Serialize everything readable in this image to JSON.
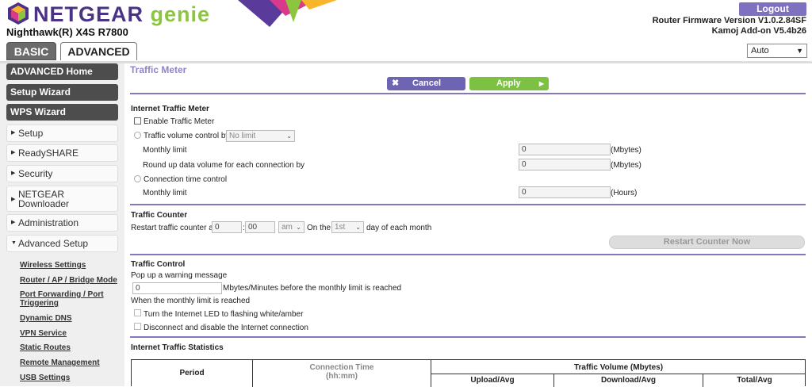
{
  "header": {
    "brand": "NETGEAR",
    "brand_suffix": "genie",
    "model": "Nighthawk(R) X4S R7800",
    "logout_label": "Logout",
    "firmware": "Router Firmware Version V1.0.2.84SF",
    "addon": "Kamoj Add-on V5.4b26",
    "tabs": {
      "basic": "BASIC",
      "advanced": "ADVANCED"
    },
    "language": "Auto"
  },
  "sidebar": {
    "buttons": [
      "ADVANCED Home",
      "Setup Wizard",
      "WPS Wizard"
    ],
    "menus": [
      "Setup",
      "ReadySHARE",
      "Security",
      "NETGEAR Downloader",
      "Administration",
      "Advanced Setup"
    ],
    "submenu": [
      "Wireless Settings",
      "Router / AP / Bridge Mode",
      "Port Forwarding / Port Triggering",
      "Dynamic DNS",
      "VPN Service",
      "Static Routes",
      "Remote Management",
      "USB Settings"
    ]
  },
  "main": {
    "title": "Traffic Meter",
    "cancel_label": "Cancel",
    "apply_label": "Apply",
    "meter": {
      "heading": "Internet Traffic Meter",
      "enable_label": "Enable Traffic Meter",
      "volume_label": "Traffic volume control by",
      "volume_select": "No limit",
      "monthly_limit_label": "Monthly limit",
      "monthly_limit_value": "0",
      "mbytes_unit": "(Mbytes)",
      "roundup_label": "Round up data volume for each connection by",
      "roundup_value": "0",
      "roundup_unit": "(Mbytes)",
      "time_label": "Connection time control",
      "time_limit_label": "Monthly limit",
      "time_limit_value": "0",
      "hours_unit": "(Hours)"
    },
    "counter": {
      "heading": "Traffic Counter",
      "restart_label": "Restart traffic counter at",
      "hour": "0",
      "colon": ":",
      "minute": "00",
      "ampm": "am",
      "on_label": "On the",
      "day": "1st",
      "day_suffix": "day of each month",
      "restart_button": "Restart Counter Now"
    },
    "control": {
      "heading": "Traffic Control",
      "popup_label": "Pop up a warning message",
      "popup_value": "0",
      "popup_suffix": "Mbytes/Minutes before the monthly limit is reached",
      "reached_label": "When the monthly limit is reached",
      "led_label": "Turn the Internet LED to flashing white/amber",
      "disconnect_label": "Disconnect and disable the Internet connection"
    },
    "stats": {
      "heading": "Internet Traffic Statistics",
      "col_period": "Period",
      "col_conn_time": "Connection Time",
      "col_conn_unit": "(hh:mm)",
      "col_volume": "Traffic Volume (Mbytes)",
      "col_upload": "Upload/Avg",
      "col_download": "Download/Avg",
      "col_total": "Total/Avg"
    }
  },
  "colors": {
    "purple": "#8378bf",
    "green": "#7cc142",
    "dark": "#4d4d4d"
  }
}
